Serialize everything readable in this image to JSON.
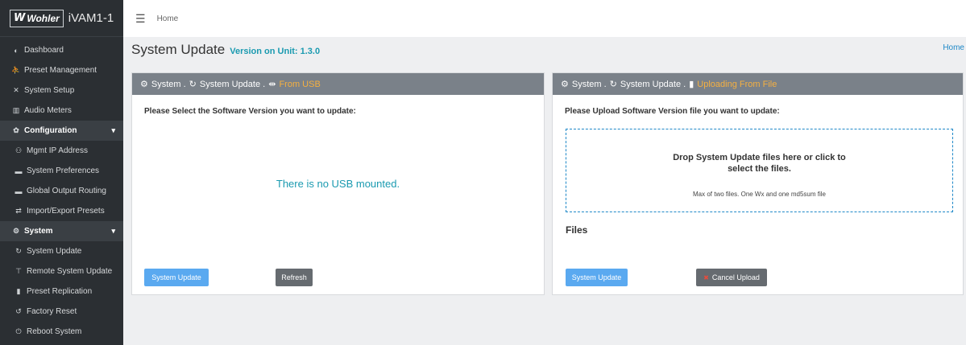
{
  "brand": {
    "logo_text": "Wohler",
    "model": "iVAM1-1"
  },
  "sidebar": {
    "items": [
      {
        "label": "Dashboard",
        "icon": "dashboard-icon",
        "glyph": "◐"
      },
      {
        "label": "Preset Management",
        "icon": "user-icon",
        "glyph": "👤"
      },
      {
        "label": "System Setup",
        "icon": "tools-icon",
        "glyph": "✕"
      },
      {
        "label": "Audio Meters",
        "icon": "bar-chart-icon",
        "glyph": "▥"
      }
    ],
    "config_group": {
      "label": "Configuration",
      "icon": "gear-icon",
      "glyph": "✿"
    },
    "config_items": [
      {
        "label": "Mgmt IP Address",
        "icon": "network-icon",
        "glyph": "⚇"
      },
      {
        "label": "System Preferences",
        "icon": "keyboard-icon",
        "glyph": "▬"
      },
      {
        "label": "Global Output Routing",
        "icon": "keyboard-icon",
        "glyph": "▬"
      },
      {
        "label": "Import/Export Presets",
        "icon": "exchange-icon",
        "glyph": "⇄"
      }
    ],
    "system_group": {
      "label": "System",
      "icon": "gears-icon",
      "glyph": "⚙"
    },
    "system_items": [
      {
        "label": "System Update",
        "icon": "refresh-icon",
        "glyph": "↻"
      },
      {
        "label": "Remote System Update",
        "icon": "antenna-icon",
        "glyph": "⊤"
      },
      {
        "label": "Preset Replication",
        "icon": "copy-icon",
        "glyph": "▮"
      },
      {
        "label": "Factory Reset",
        "icon": "undo-icon",
        "glyph": "↺"
      },
      {
        "label": "Reboot System",
        "icon": "power-icon",
        "glyph": "⏻"
      }
    ]
  },
  "topbar": {
    "breadcrumb": "Home"
  },
  "page": {
    "title": "System Update",
    "version": "Version on Unit: 1.3.0",
    "home_link": "Home"
  },
  "left_panel": {
    "head_system": "System .",
    "head_update": "System Update .",
    "head_source": "From USB",
    "prompt": "Please Select the Software Version you want to update:",
    "status": "There is no USB mounted.",
    "update_button": "System Update",
    "refresh_button": "Refresh"
  },
  "right_panel": {
    "head_system": "System .",
    "head_update": "System Update .",
    "head_source": "Uploading From File",
    "prompt": "Please Upload Software Version file you want to update:",
    "drop_line1": "Drop System Update files here or click to",
    "drop_line2": "select the files.",
    "drop_hint": "Max of two files. One Wx and one md5sum file",
    "files_heading": "Files",
    "update_button": "System Update",
    "cancel_button": "Cancel Upload"
  },
  "colors": {
    "sidebar_bg": "#2b2f33",
    "panel_head": "#7a8189",
    "accent": "#1a9ab0",
    "highlight": "#f5b041",
    "primary_btn": "#5aa9f0"
  }
}
